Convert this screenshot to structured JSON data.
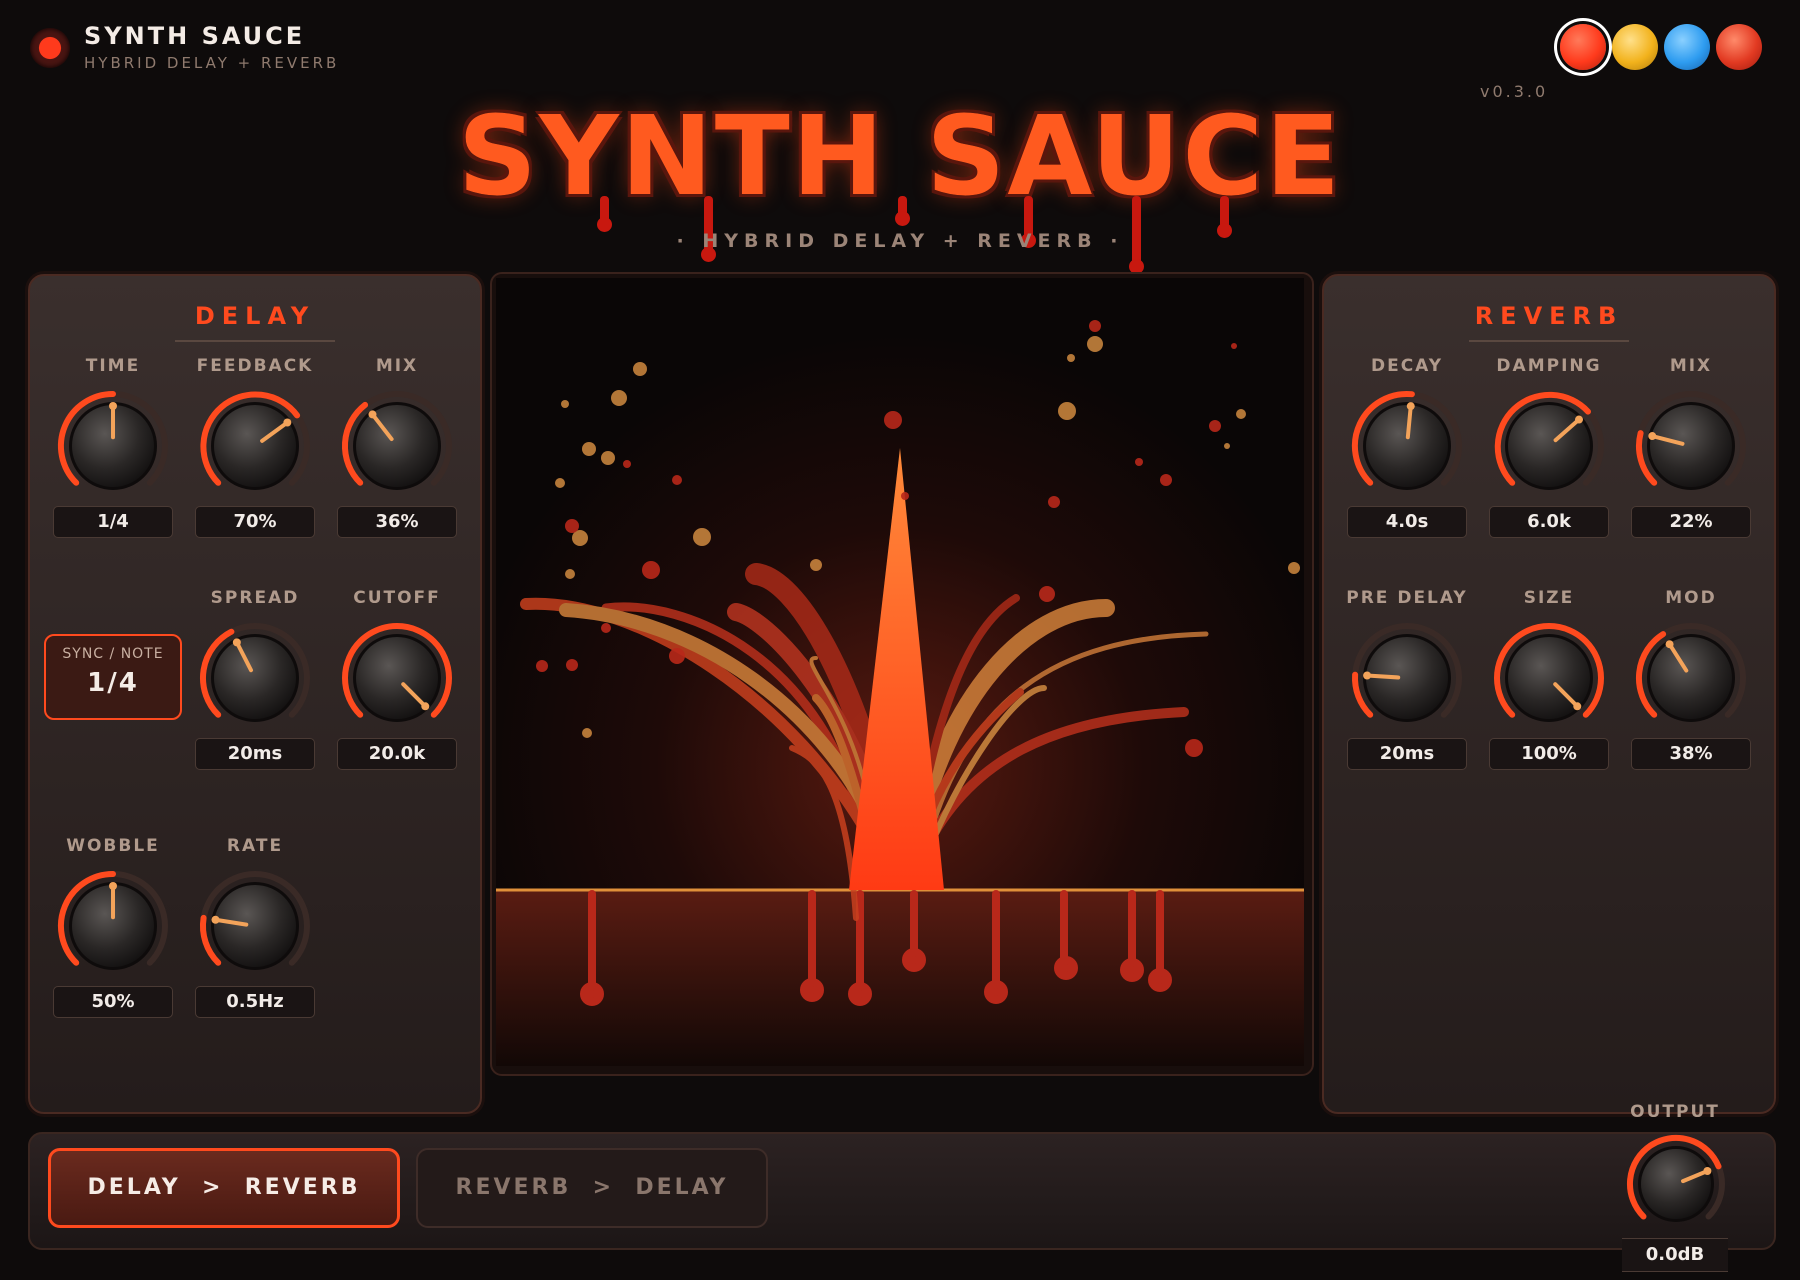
{
  "header": {
    "brand_name": "SYNTH SAUCE",
    "brand_sub": "HYBRID DELAY + REVERB",
    "version": "v0.3.0",
    "themes": [
      {
        "name": "red",
        "color": "#ff3a1c",
        "selected": true
      },
      {
        "name": "yellow",
        "color": "#f2b21c",
        "selected": false
      },
      {
        "name": "blue",
        "color": "#2e9cf0",
        "selected": false
      },
      {
        "name": "red-alt",
        "color": "#e23a22",
        "selected": false
      }
    ]
  },
  "hero": {
    "title": "SYNTH SAUCE",
    "tagline": "· HYBRID DELAY + REVERB ·"
  },
  "delay": {
    "title": "DELAY",
    "time": {
      "label": "TIME",
      "value": "1/4",
      "level": 0.5
    },
    "feedback": {
      "label": "FEEDBACK",
      "value": "70%",
      "level": 0.7
    },
    "mix": {
      "label": "MIX",
      "value": "36%",
      "level": 0.36
    },
    "sync_label": "SYNC / NOTE",
    "sync_value": "1/4",
    "spread": {
      "label": "SPREAD",
      "value": "20ms",
      "level": 0.4
    },
    "cutoff": {
      "label": "CUTOFF",
      "value": "20.0k",
      "level": 1.0
    },
    "wobble": {
      "label": "WOBBLE",
      "value": "50%",
      "level": 0.5
    },
    "rate": {
      "label": "RATE",
      "value": "0.5Hz",
      "level": 0.2
    }
  },
  "reverb": {
    "title": "REVERB",
    "decay": {
      "label": "DECAY",
      "value": "4.0s",
      "level": 0.52
    },
    "damping": {
      "label": "DAMPING",
      "value": "6.0k",
      "level": 0.68
    },
    "mix": {
      "label": "MIX",
      "value": "22%",
      "level": 0.22
    },
    "pre_delay": {
      "label": "PRE DELAY",
      "value": "20ms",
      "level": 0.18
    },
    "size": {
      "label": "SIZE",
      "value": "100%",
      "level": 1.0
    },
    "mod": {
      "label": "MOD",
      "value": "38%",
      "level": 0.38
    }
  },
  "routing": {
    "option_a": "DELAY  >  REVERB",
    "option_b": "REVERB  >  DELAY",
    "selected": "option_a"
  },
  "output": {
    "label": "OUTPUT",
    "value": "0.0dB",
    "level": 0.75
  },
  "colors": {
    "accent": "#ff4a1e",
    "knob_track": "#3a2a26",
    "indicator": "#f3a35a"
  }
}
